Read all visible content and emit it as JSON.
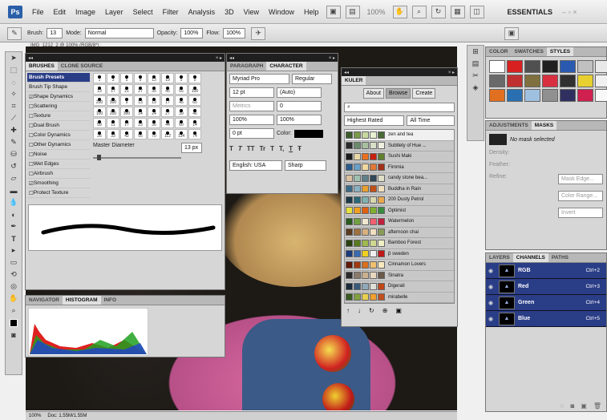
{
  "app": {
    "logo": "Ps"
  },
  "menu": [
    "File",
    "Edit",
    "Image",
    "Layer",
    "Select",
    "Filter",
    "Analysis",
    "3D",
    "View",
    "Window",
    "Help"
  ],
  "zoom_menu": "100%",
  "workspace": "ESSENTIALS",
  "options": {
    "brush_label": "Brush:",
    "brush_size": "13",
    "mode_label": "Mode:",
    "mode_value": "Normal",
    "opacity_label": "Opacity:",
    "opacity_value": "100%",
    "flow_label": "Flow:",
    "flow_value": "100%"
  },
  "doc_tab": "IMG_1212_2 @ 100% (RGB/8*)",
  "brushes_panel": {
    "tabs": [
      "BRUSHES",
      "CLONE SOURCE"
    ],
    "presets_label": "Brush Presets",
    "options": [
      "Brush Tip Shape",
      "Shape Dynamics",
      "Scattering",
      "Texture",
      "Dual Brush",
      "Color Dynamics",
      "Other Dynamics",
      "Noise",
      "Wet Edges",
      "Airbrush",
      "Smoothing",
      "Protect Texture"
    ],
    "checked": [
      false,
      true,
      false,
      false,
      false,
      false,
      false,
      false,
      false,
      false,
      true,
      false
    ],
    "sizes": [
      "1",
      "3",
      "5",
      "9",
      "13",
      "19",
      "5",
      "9",
      "13",
      "17",
      "21",
      "27",
      "35",
      "45",
      "65",
      "100",
      "200",
      "300",
      "9",
      "13",
      "19",
      "17",
      "45",
      "65",
      "100",
      "200",
      "300",
      "14",
      "24",
      "27",
      "39",
      "46",
      "59",
      "11",
      "17",
      "23",
      "36",
      "44",
      "60",
      "14",
      "26",
      "33",
      "42",
      "55",
      "70",
      "112",
      "134",
      "74"
    ],
    "master_label": "Master Diameter",
    "master_value": "13 px"
  },
  "histogram_panel": {
    "tabs": [
      "NAVIGATOR",
      "HISTOGRAM",
      "INFO"
    ]
  },
  "character_panel": {
    "tabs": [
      "PARAGRAPH",
      "CHARACTER"
    ],
    "font": "Myriad Pro",
    "style": "Regular",
    "size": "12 pt",
    "leading": "(Auto)",
    "kerning": "Metrics",
    "tracking": "0",
    "vscale": "100%",
    "hscale": "100%",
    "baseline": "0 pt",
    "color_label": "Color:",
    "lang": "English: USA",
    "aa": "Sharp",
    "type_styles": [
      "T",
      "T",
      "TT",
      "Tr",
      "T",
      "T,",
      "T",
      "Ŧ"
    ]
  },
  "kuler_panel": {
    "title": "KULER",
    "tabs": [
      "About",
      "Browse",
      "Create"
    ],
    "filter": "Highest Rated",
    "time": "All Time",
    "themes": [
      {
        "name": "zen and tea",
        "colors": [
          "#3c5a2a",
          "#7a9a4a",
          "#c8d8a0",
          "#e8f0d0",
          "#4a6a38"
        ]
      },
      {
        "name": "Subtlety of Hue ...",
        "colors": [
          "#2a2a2a",
          "#6a8a6a",
          "#a8c0a0",
          "#d8e0c8",
          "#f0f0e0"
        ]
      },
      {
        "name": "Sushi Maki",
        "colors": [
          "#1a1a1a",
          "#e8d8a8",
          "#e87020",
          "#c82010",
          "#608030"
        ]
      },
      {
        "name": "Fimmia",
        "colors": [
          "#2a5a8a",
          "#6aa0c8",
          "#f0d8a0",
          "#e07838",
          "#a03018"
        ]
      },
      {
        "name": "candy stone bea...",
        "colors": [
          "#d8c0a0",
          "#a0c0b0",
          "#608088",
          "#304858",
          "#e0e0c8"
        ]
      },
      {
        "name": "Buddha in Rain",
        "colors": [
          "#3a6a88",
          "#8ab0c0",
          "#e8a030",
          "#c05018",
          "#f0e0c0"
        ]
      },
      {
        "name": "200 Dusty Petrol",
        "colors": [
          "#1a3848",
          "#2a6878",
          "#80b0b0",
          "#d8d8b0",
          "#e8a850"
        ]
      },
      {
        "name": "Optimist",
        "colors": [
          "#e8e040",
          "#f0a020",
          "#e06010",
          "#80b030",
          "#3a8a40"
        ]
      },
      {
        "name": "Watermelon",
        "colors": [
          "#2a5a20",
          "#70a040",
          "#f0e8d0",
          "#f06070",
          "#c02040"
        ]
      },
      {
        "name": "afternoon chai",
        "colors": [
          "#5a3a20",
          "#a07040",
          "#d8b080",
          "#f0e0c0",
          "#8a9a5a"
        ]
      },
      {
        "name": "Bamboo Forest",
        "colors": [
          "#2a4010",
          "#5a7a20",
          "#a0b850",
          "#d0d890",
          "#f0f0c8"
        ]
      },
      {
        "name": "β sweden",
        "colors": [
          "#1a3a7a",
          "#3a6ab0",
          "#f0d020",
          "#f0f0f0",
          "#c01818"
        ]
      },
      {
        "name": "Cinnamon Lovers",
        "colors": [
          "#601808",
          "#a03a10",
          "#d87020",
          "#f0c070",
          "#f8e8c0"
        ]
      },
      {
        "name": "Sinatra",
        "colors": [
          "#2a2a2a",
          "#8a7a6a",
          "#c8b090",
          "#e8d8c0",
          "#6a5a4a"
        ]
      },
      {
        "name": "Digerati",
        "colors": [
          "#1a2a3a",
          "#3a5a7a",
          "#90a8b8",
          "#e0e0d8",
          "#c04818"
        ]
      },
      {
        "name": "mirabelle",
        "colors": [
          "#3a5a20",
          "#80a040",
          "#e8d050",
          "#f0a030",
          "#c05020"
        ]
      }
    ]
  },
  "color_panel": {
    "tabs": [
      "COLOR",
      "SWATCHES",
      "STYLES"
    ],
    "styles": [
      "#ffffff",
      "#d82020",
      "#505050",
      "#202020",
      "#2a5ab0",
      "#c0c0c0",
      "#e8e8e8",
      "#6a6a6a",
      "#c03030",
      "#807040",
      "#d83040",
      "#303030",
      "#e8d030",
      "#f0f0f0",
      "#e07020",
      "#2a70b0",
      "#a0c0e0",
      "#909090",
      "#303060",
      "#d02050",
      "#f8f8f8"
    ]
  },
  "adjustments_panel": {
    "tabs": [
      "ADJUSTMENTS",
      "MASKS"
    ],
    "no_mask": "No mask selected",
    "density": "Density:",
    "feather": "Feather:",
    "refine": "Refine:",
    "buttons": [
      "Mask Edge...",
      "Color Range...",
      "Invert"
    ]
  },
  "layers_panel": {
    "tabs": [
      "LAYERS",
      "CHANNELS",
      "PATHS"
    ],
    "channels": [
      {
        "name": "RGB",
        "shortcut": "Ctrl+2"
      },
      {
        "name": "Red",
        "shortcut": "Ctrl+3"
      },
      {
        "name": "Green",
        "shortcut": "Ctrl+4"
      },
      {
        "name": "Blue",
        "shortcut": "Ctrl+5"
      }
    ]
  },
  "status": {
    "zoom": "100%",
    "doc": "Doc: 1.55M/1.55M"
  }
}
